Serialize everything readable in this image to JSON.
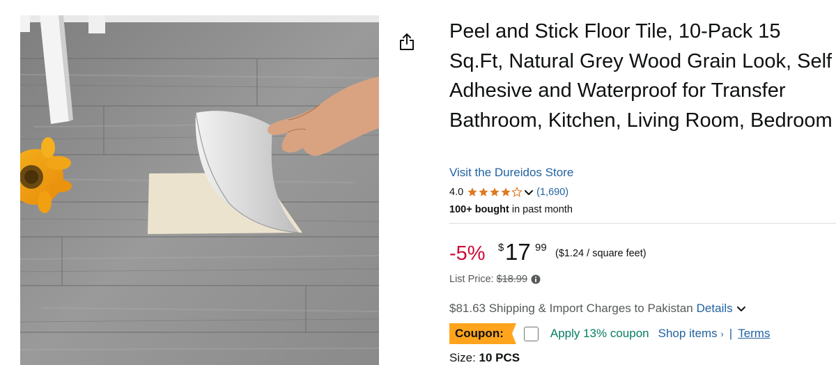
{
  "product": {
    "image_alt": "Peel and stick grey wood grain floor tile being peeled by hand",
    "title": "Peel and Stick Floor Tile, 10-Pack 15 Sq.Ft, Natural Grey Wood Grain Look, Self Adhesive and Waterproof for Transfer Bathroom, Kitchen, Living Room, Bedroom",
    "store_link": "Visit the Dureidos Store"
  },
  "rating": {
    "value": "4.0",
    "stars_filled": 4,
    "stars_total": 5,
    "count": "(1,690)"
  },
  "bought": {
    "bold": "100+ bought",
    "rest": " in past month"
  },
  "price": {
    "discount": "-5%",
    "currency": "$",
    "whole": "17",
    "fraction": "99",
    "unit_price": "($1.24 / square feet)",
    "list_label": "List Price:",
    "list_value": "$18.99"
  },
  "shipping": {
    "text": "$81.63 Shipping & Import Charges to Pakistan",
    "details_link": "Details"
  },
  "coupon": {
    "badge": "Coupon:",
    "checked": false,
    "apply_text": "Apply 13% coupon",
    "shop_items": "Shop items",
    "shop_items_arrow": "›",
    "separator": "|",
    "terms": "Terms"
  },
  "size": {
    "label": "Size:",
    "value": "10 PCS"
  },
  "colors": {
    "title": "#0f1111",
    "link": "#2162a1",
    "discount": "#cc0c39",
    "star": "#de7921",
    "coupon_badge": "#ffa41c",
    "coupon_apply": "#067d62"
  },
  "icons": {
    "share": "share-icon",
    "star": "star-icon",
    "chevron": "chevron-down-icon",
    "info": "info-icon"
  }
}
